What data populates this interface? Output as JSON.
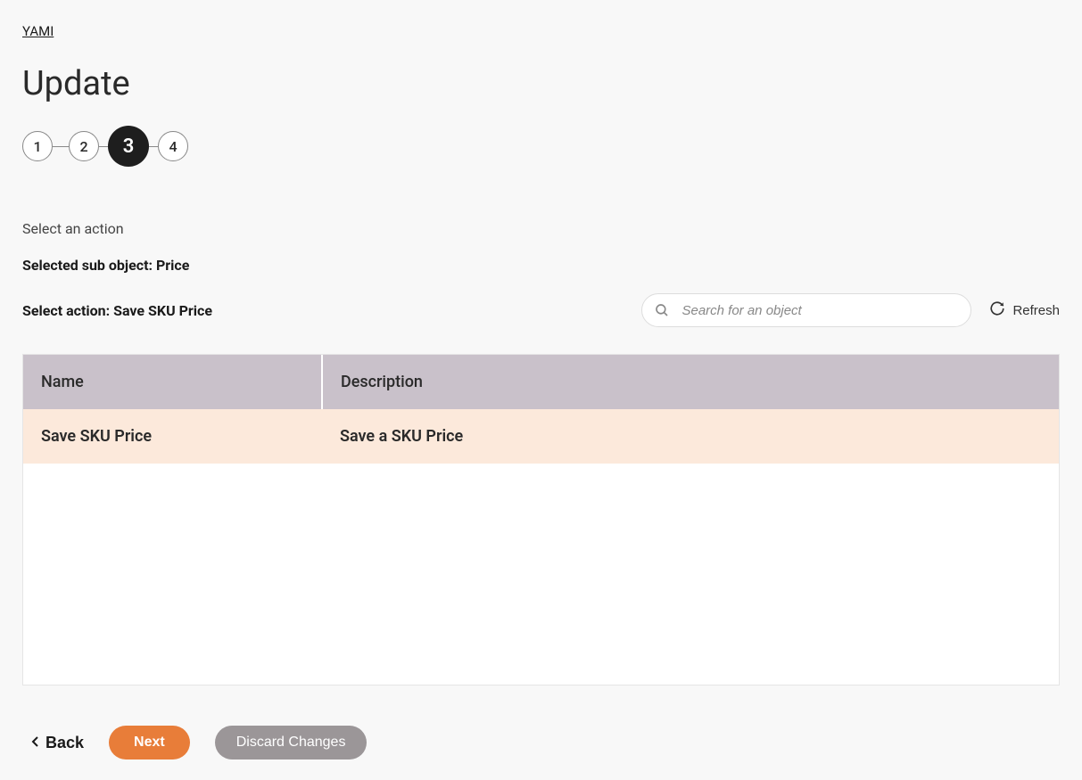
{
  "breadcrumb": "YAMI",
  "page_title": "Update",
  "stepper": {
    "steps": [
      "1",
      "2",
      "3",
      "4"
    ],
    "active_index": 2
  },
  "section_label": "Select an action",
  "selected_sub_object_line": "Selected sub object: Price",
  "select_action_line": "Select action: Save SKU Price",
  "search": {
    "placeholder": "Search for an object"
  },
  "refresh_label": "Refresh",
  "table": {
    "headers": {
      "name": "Name",
      "description": "Description"
    },
    "rows": [
      {
        "name": "Save SKU Price",
        "description": "Save a SKU Price",
        "selected": true
      }
    ]
  },
  "footer": {
    "back": "Back",
    "next": "Next",
    "discard": "Discard Changes"
  }
}
